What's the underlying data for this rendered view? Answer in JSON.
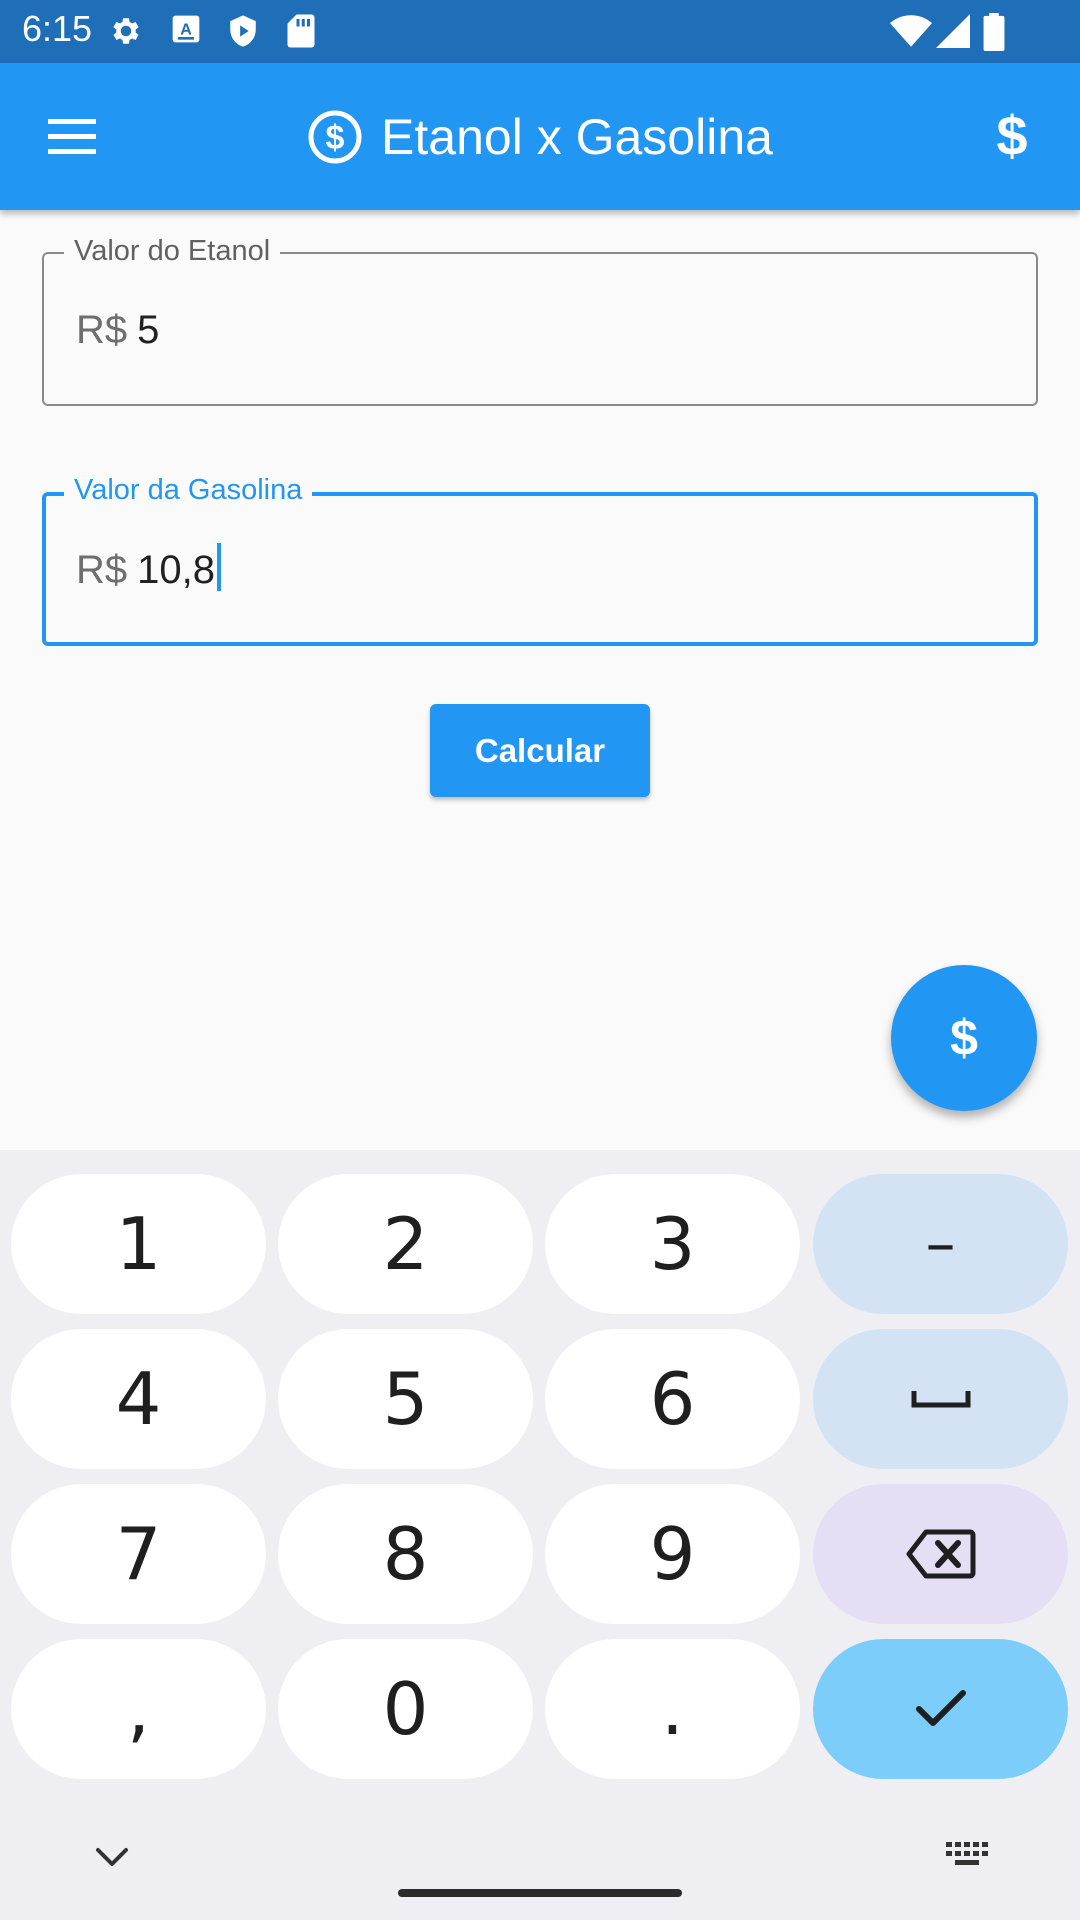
{
  "status_bar": {
    "time": "6:15",
    "left_icons": [
      "gear-icon",
      "font-a-icon",
      "shield-play-icon",
      "sd-card-icon"
    ],
    "right_icons": [
      "wifi-icon",
      "signal-icon",
      "battery-icon"
    ]
  },
  "app_bar": {
    "title": "Etanol x Gasolina",
    "action_symbol": "$",
    "color": "#2196f3"
  },
  "form": {
    "etanol": {
      "label": "Valor do Etanol",
      "prefix": "R$",
      "value": "5"
    },
    "gasolina": {
      "label": "Valor da Gasolina",
      "prefix": "R$",
      "value": "10,8",
      "focused": true
    },
    "calculate_label": "Calcular"
  },
  "fab": {
    "symbol": "$"
  },
  "keyboard": {
    "rows": [
      [
        "1",
        "2",
        "3",
        "–"
      ],
      [
        "4",
        "5",
        "6",
        "space-icon"
      ],
      [
        "7",
        "8",
        "9",
        "backspace-icon"
      ],
      [
        ",",
        "0",
        ".",
        "check-icon"
      ]
    ],
    "bottom_icons": [
      "chevron-down-icon",
      "keyboard-icon"
    ]
  }
}
